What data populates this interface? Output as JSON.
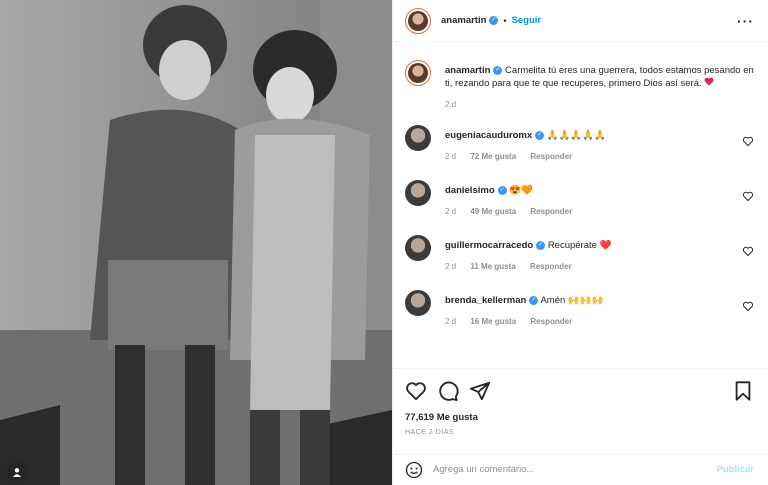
{
  "post": {
    "author": "anamartin",
    "follow_label": "Seguir",
    "caption_text": "Carmelita tú eres una guerrera, todos estamos pesando en ti, rezando para que te que recuperes, primero Dios así será.",
    "caption_time": "2 d",
    "likes": "77,619 Me gusta",
    "posted_ago": "HACE 2 DÍAS",
    "comment_placeholder": "Agrega un comentario...",
    "publish_label": "Publicar"
  },
  "comments": [
    {
      "user": "eugeniacauduromx",
      "text": "🙏🙏🙏🙏🙏",
      "time": "2 d",
      "likes": "72 Me gusta",
      "reply": "Responder"
    },
    {
      "user": "danielsimo",
      "text": "😍🧡",
      "time": "2 d",
      "likes": "49 Me gusta",
      "reply": "Responder"
    },
    {
      "user": "guillermocarracedo",
      "text": "Recupérate ❤️",
      "time": "2 d",
      "likes": "11 Me gusta",
      "reply": "Responder"
    },
    {
      "user": "brenda_kellerman",
      "text": "Amén 🙌🙌🙌",
      "time": "2 d",
      "likes": "16 Me gusta",
      "reply": "Responder"
    }
  ],
  "icons": {
    "verified": "verified-badge-icon",
    "more": "more-options-icon",
    "heart": "heart-icon",
    "comment": "comment-icon",
    "share": "share-icon",
    "save": "bookmark-icon",
    "emoji": "emoji-icon",
    "user": "user-tag-icon"
  },
  "colors": {
    "accent": "#0095f6",
    "verified": "#3897f0",
    "heart": "#ed4956"
  }
}
